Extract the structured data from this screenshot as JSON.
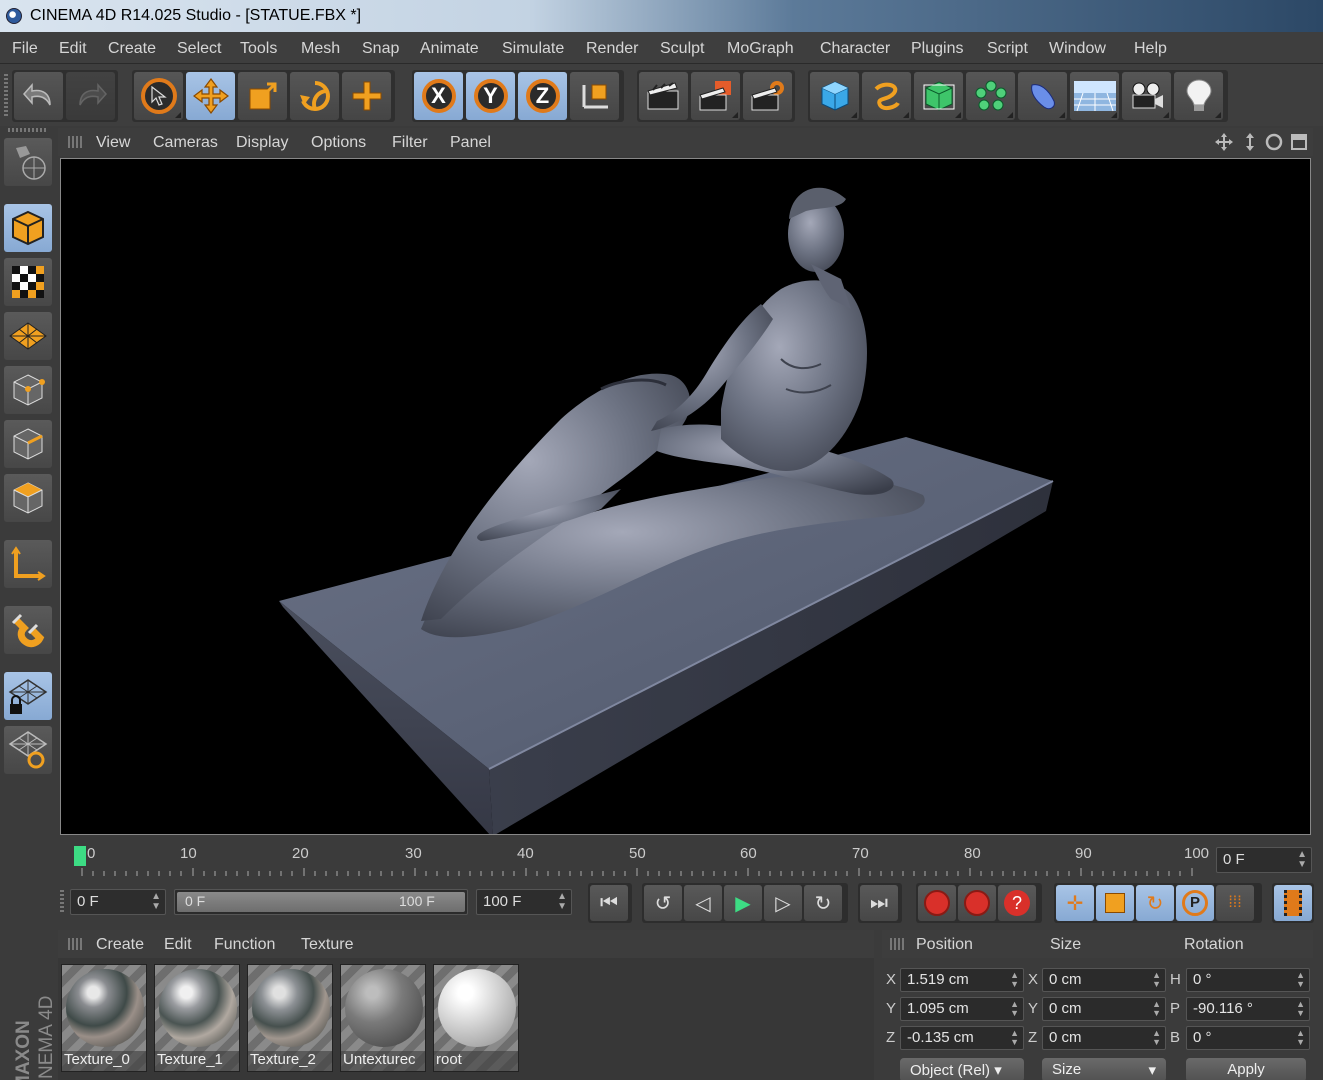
{
  "window": {
    "title": "CINEMA 4D R14.025 Studio - [STATUE.FBX *]"
  },
  "menubar": [
    "File",
    "Edit",
    "Create",
    "Select",
    "Tools",
    "Mesh",
    "Snap",
    "Animate",
    "Simulate",
    "Render",
    "Sculpt",
    "MoGraph",
    "Character",
    "Plugins",
    "Script",
    "Window",
    "Help"
  ],
  "toolbar": {
    "history": [
      "undo-icon",
      "redo-icon"
    ],
    "tools": [
      "live-selection-icon",
      "move-icon",
      "scale-icon",
      "rotate-icon",
      "add-icon"
    ],
    "axes": [
      "X",
      "Y",
      "Z"
    ],
    "coord_system": "world-coordinate-icon",
    "render": [
      "render-view-icon",
      "render-picture-viewer-icon",
      "render-settings-icon"
    ],
    "objects": [
      "cube-icon",
      "spline-pen-icon",
      "subdivision-icon",
      "array-icon",
      "deformer-icon",
      "floor-icon",
      "camera-icon",
      "light-icon"
    ]
  },
  "leftbar": [
    "convert-icon",
    "model-mode-icon",
    "texture-mode-icon",
    "workplane-mode-icon",
    "points-mode-icon",
    "edges-mode-icon",
    "polygons-mode-icon",
    "axis-mode-icon",
    "magnet-icon",
    "lock-workplane-icon",
    "workplane-icon"
  ],
  "viewport": {
    "menu": [
      "View",
      "Cameras",
      "Display",
      "Options",
      "Filter",
      "Panel"
    ]
  },
  "timeline": {
    "ticks": [
      "0",
      "10",
      "20",
      "30",
      "40",
      "50",
      "60",
      "70",
      "80",
      "90",
      "100"
    ],
    "current_frame": "0 F"
  },
  "transport": {
    "start_field": "0 F",
    "range_start": "0 F",
    "range_end": "100 F",
    "end_field": "100 F"
  },
  "materials": {
    "menu": [
      "Create",
      "Edit",
      "Function",
      "Texture"
    ],
    "items": [
      "Texture_0",
      "Texture_1",
      "Texture_2",
      "Untexturec",
      "root"
    ]
  },
  "coordinates": {
    "headers": [
      "Position",
      "Size",
      "Rotation"
    ],
    "position": {
      "x": "1.519 cm",
      "y": "1.095 cm",
      "z": "-0.135 cm"
    },
    "size": {
      "x": "0 cm",
      "y": "0 cm",
      "z": "0 cm"
    },
    "rotation": {
      "h": "0 °",
      "p": "-90.116 °",
      "b": "0 °"
    },
    "axis_labels": [
      "X",
      "Y",
      "Z"
    ],
    "rot_labels": [
      "H",
      "P",
      "B"
    ],
    "mode": "Object (Rel)",
    "size_mode": "Size",
    "apply": "Apply"
  },
  "brand": {
    "maxon": "MAXON",
    "product": "CINEMA 4D"
  },
  "colors": {
    "accent": "#e07a1a",
    "active": "#93b3db",
    "background": "#3b3b3b"
  }
}
